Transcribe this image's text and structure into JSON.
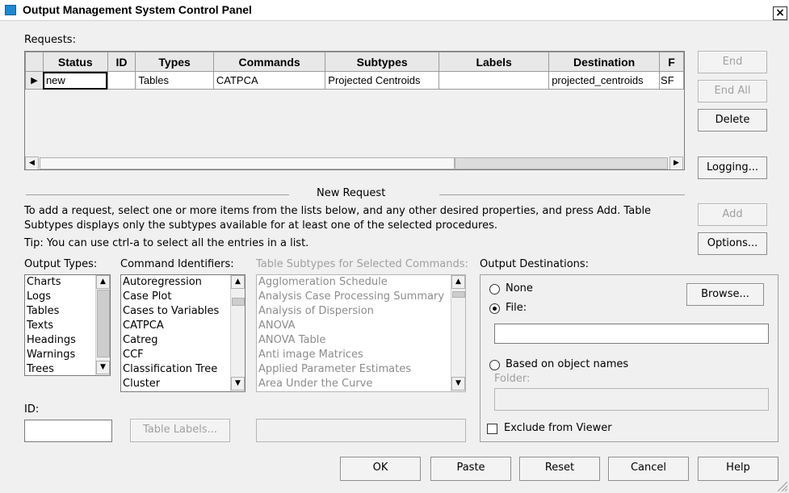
{
  "window": {
    "title": "Output Management System Control Panel",
    "close_glyph": "×"
  },
  "requests": {
    "label": "Requests:",
    "columns": [
      "Status",
      "ID",
      "Types",
      "Commands",
      "Subtypes",
      "Labels",
      "Destination",
      "F"
    ],
    "rows": [
      {
        "marker": "▶",
        "status": "new",
        "id": "",
        "types": "Tables",
        "commands": "CATPCA",
        "subtypes": "Projected Centroids",
        "labels": "",
        "destination": "projected_centroids",
        "f": "SF"
      }
    ]
  },
  "side_buttons": {
    "end": "End",
    "end_all": "End All",
    "delete": "Delete",
    "logging": "Logging...",
    "add": "Add",
    "options": "Options..."
  },
  "new_request": {
    "heading": "New Request",
    "instructions_line1": "To add a request, select one or more items from the lists below, and any other desired properties, and press Add. Table",
    "instructions_line2": "Subtypes displays only the subtypes available for at least one of the selected procedures.",
    "tip": "Tip: You can use ctrl-a to select all the entries in a list."
  },
  "output_types": {
    "label": "Output Types:",
    "items": [
      "Charts",
      "Logs",
      "Tables",
      "Texts",
      "Headings",
      "Warnings",
      "Trees"
    ]
  },
  "command_identifiers": {
    "label": "Command Identifiers:",
    "items": [
      "Autoregression",
      "Case Plot",
      "Cases to Variables",
      "CATPCA",
      "Catreg",
      "CCF",
      "Classification Tree",
      "Cluster"
    ]
  },
  "table_subtypes": {
    "label": "Table Subtypes for Selected Commands:",
    "items": [
      "Agglomeration Schedule",
      "Analysis Case Processing Summary",
      "Analysis of Dispersion",
      "ANOVA",
      "ANOVA Table",
      "Anti image Matrices",
      "Applied Parameter Estimates",
      "Area Under the Curve"
    ]
  },
  "output_destinations": {
    "label": "Output Destinations:",
    "none": "None",
    "file": "File:",
    "file_value": "",
    "based_on_object_names": "Based on object names",
    "folder": "Folder:",
    "folder_value": "",
    "browse": "Browse...",
    "exclude_from_viewer": "Exclude from Viewer",
    "selected": "File"
  },
  "id_field": {
    "label": "ID:",
    "value": ""
  },
  "table_labels_button": "Table Labels...",
  "table_labels_value": "",
  "footer": {
    "ok": "OK",
    "paste": "Paste",
    "reset": "Reset",
    "cancel": "Cancel",
    "help": "Help"
  }
}
